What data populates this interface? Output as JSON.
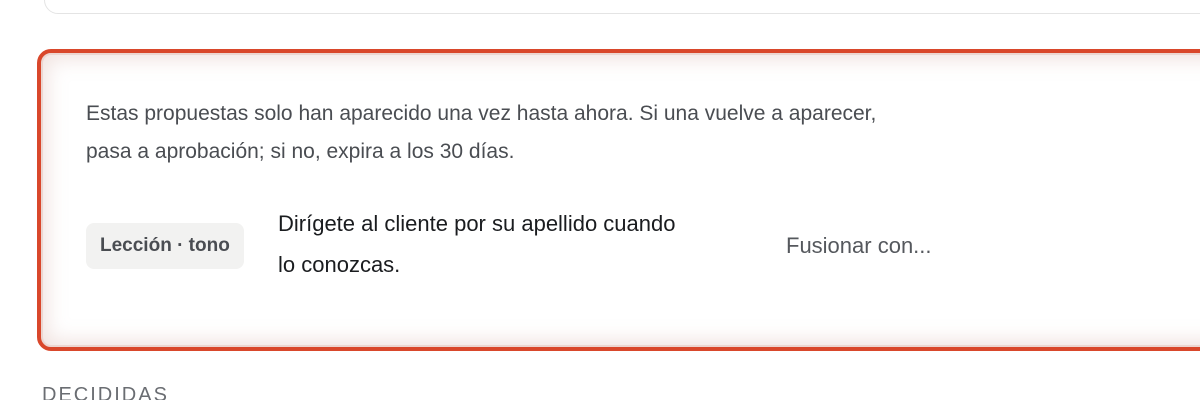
{
  "pending": {
    "intro": "Estas propuestas solo han aparecido una vez hasta ahora. Si una vuelve a aparecer, pasa a aprobación; si no, expira a los 30 días.",
    "proposals": [
      {
        "tag": "Lección · tono",
        "text": "Dirígete al cliente por su apellido cuando lo conozcas.",
        "merge_label": "Fusionar con..."
      }
    ],
    "highlight_color": "#d9472b"
  },
  "decided": {
    "heading": "DECIDIDAS"
  }
}
